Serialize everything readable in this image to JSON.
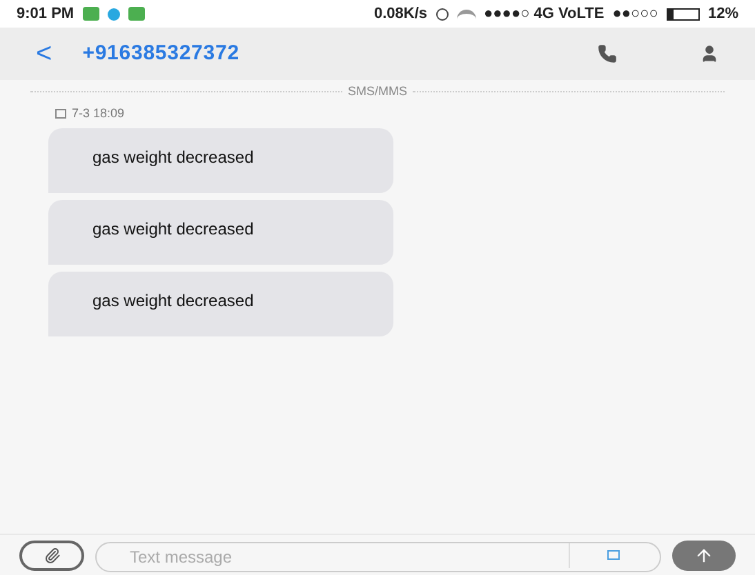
{
  "status_bar": {
    "time": "9:01 PM",
    "speed": "0.08K/s",
    "network": "●●●●○ 4G VoLTE",
    "signal": "●●○○○",
    "battery": "12%"
  },
  "header": {
    "back": "<",
    "contact": "+916385327372"
  },
  "divider_label": "SMS/MMS",
  "timestamp": "7-3 18:09",
  "messages": [
    {
      "text": "gas weight decreased"
    },
    {
      "text": "gas weight decreased"
    },
    {
      "text": "gas weight decreased"
    }
  ],
  "composer": {
    "placeholder": "Text message"
  }
}
